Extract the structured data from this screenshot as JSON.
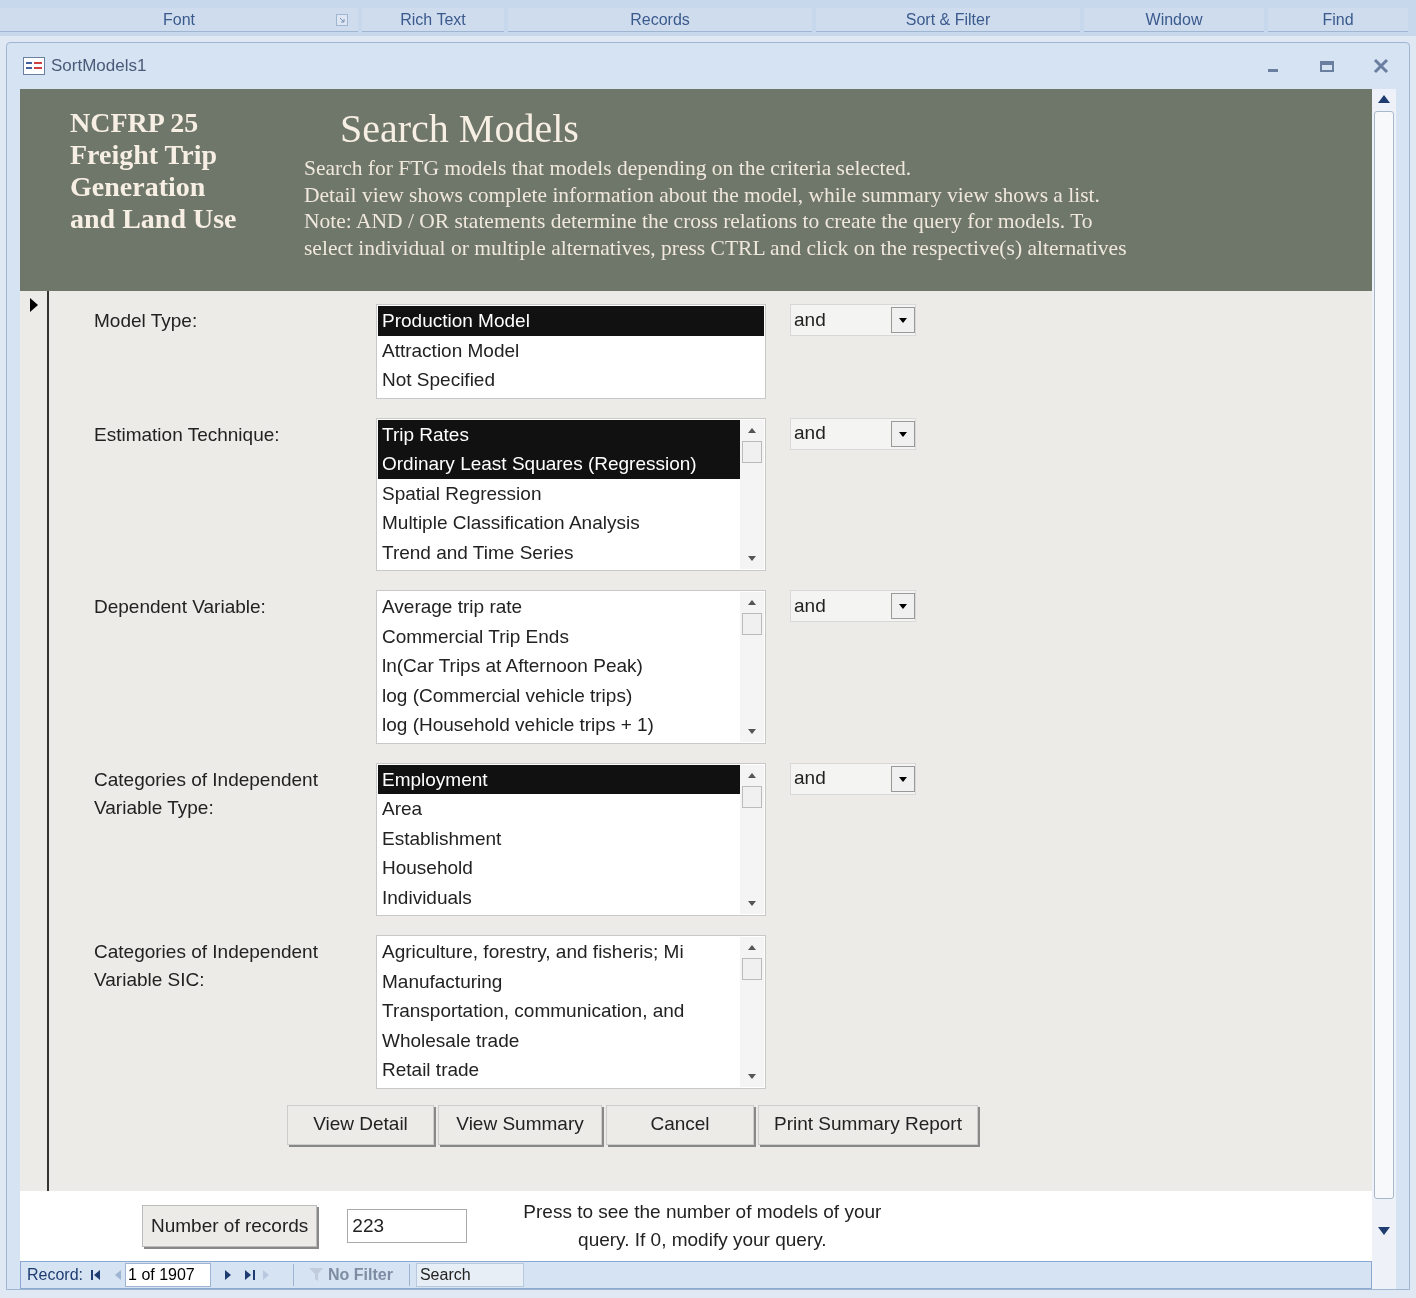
{
  "ribbon_groups": [
    {
      "label": "Font",
      "launcher": true
    },
    {
      "label": "Rich Text",
      "launcher": false
    },
    {
      "label": "Records",
      "launcher": false
    },
    {
      "label": "Sort & Filter",
      "launcher": false
    },
    {
      "label": "Window",
      "launcher": false
    },
    {
      "label": "Find",
      "launcher": false
    }
  ],
  "window": {
    "title": "SortModels1"
  },
  "header": {
    "brand_lines": [
      "NCFRP 25",
      "Freight Trip",
      "Generation",
      "and Land Use"
    ],
    "title": "Search Models",
    "description_lines": [
      "Search for FTG models that models depending on the criteria selected.",
      "Detail view shows complete information about the model, while summary view shows a list.",
      "Note: AND / OR statements determine the cross relations to create the query for models. To",
      "select individual or multiple alternatives, press CTRL and click on the respective(s) alternatives"
    ]
  },
  "criteria": [
    {
      "label": "Model Type:",
      "scrollbar": false,
      "operator": "and",
      "items": [
        {
          "label": "Production Model",
          "selected": true
        },
        {
          "label": "Attraction Model",
          "selected": false
        },
        {
          "label": "Not Specified",
          "selected": false
        }
      ]
    },
    {
      "label": "Estimation Technique:",
      "scrollbar": true,
      "operator": "and",
      "items": [
        {
          "label": "Trip Rates",
          "selected": true
        },
        {
          "label": "Ordinary Least Squares (Regression)",
          "selected": true
        },
        {
          "label": "Spatial Regression",
          "selected": false
        },
        {
          "label": "Multiple Classification Analysis",
          "selected": false
        },
        {
          "label": "Trend and Time Series",
          "selected": false
        }
      ]
    },
    {
      "label": "Dependent Variable:",
      "scrollbar": true,
      "operator": "and",
      "items": [
        {
          "label": "Average trip rate",
          "selected": false
        },
        {
          "label": "Commercial Trip Ends",
          "selected": false
        },
        {
          "label": "ln(Car Trips at Afternoon Peak)",
          "selected": false
        },
        {
          "label": "log (Commercial vehicle trips)",
          "selected": false
        },
        {
          "label": "log (Household vehicle trips + 1)",
          "selected": false
        }
      ]
    },
    {
      "label": "Categories of Independent Variable Type:",
      "scrollbar": true,
      "operator": "and",
      "items": [
        {
          "label": "Employment",
          "selected": true
        },
        {
          "label": "Area",
          "selected": false
        },
        {
          "label": "Establishment",
          "selected": false
        },
        {
          "label": "Household",
          "selected": false
        },
        {
          "label": "Individuals",
          "selected": false
        }
      ]
    },
    {
      "label": "Categories of Independent Variable SIC:",
      "scrollbar": true,
      "items": [
        {
          "label": "Agriculture, forestry, and fisheris; Mi",
          "selected": false
        },
        {
          "label": "Manufacturing",
          "selected": false
        },
        {
          "label": "Transportation, communication, and",
          "selected": false
        },
        {
          "label": "Wholesale trade",
          "selected": false
        },
        {
          "label": "Retail trade",
          "selected": false
        }
      ]
    }
  ],
  "buttons": [
    "View Detail",
    "View Summary",
    "Cancel",
    "Print Summary Report"
  ],
  "footer": {
    "button": "Number of records",
    "value": "223",
    "hint": "Press to see the number of models of your query. If 0, modify your query."
  },
  "record_nav": {
    "label": "Record:",
    "position": "1 of 1907",
    "filter": "No Filter",
    "search_placeholder": "Search"
  }
}
